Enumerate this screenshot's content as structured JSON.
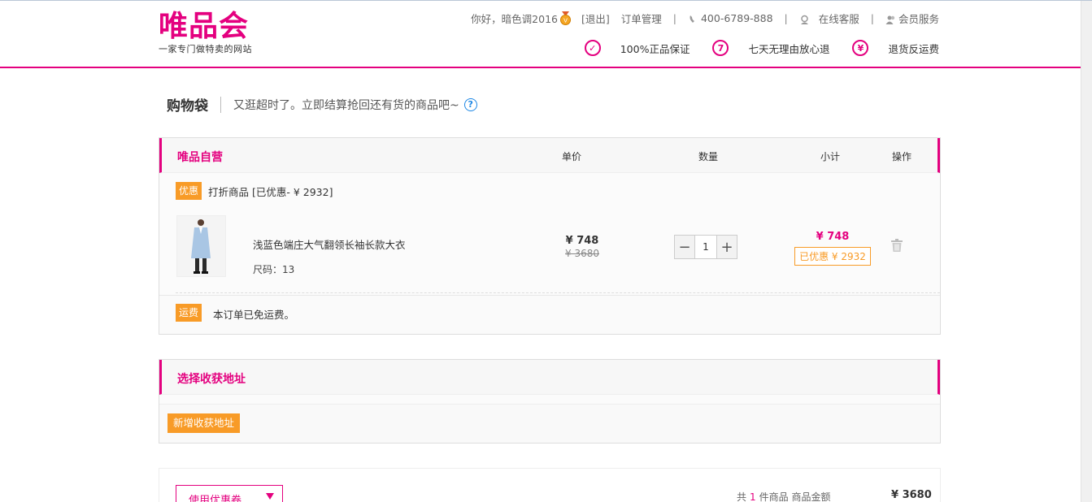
{
  "header": {
    "logo_text": "唯品会",
    "logo_sub": "一家专门做特卖的网站",
    "greeting": "你好，",
    "username": "暗色调2016",
    "logout": "[退出]",
    "orders": "订单管理",
    "phone": "400-6789-888",
    "service": "在线客服",
    "member": "会员服务",
    "separator": "|",
    "promises": [
      {
        "icon": "check-circle-icon",
        "glyph": "✓",
        "label": "100%正品保证"
      },
      {
        "icon": "seven-day-icon",
        "glyph": "7",
        "label": "七天无理由放心退"
      },
      {
        "icon": "yen-circle-icon",
        "glyph": "¥",
        "label": "退货反运费"
      }
    ]
  },
  "page": {
    "title": "购物袋",
    "notice": "又逛超时了。立即结算抢回还有货的商品吧~",
    "help_glyph": "?"
  },
  "cart": {
    "seller": "唯品自营",
    "columns": {
      "price": "单价",
      "qty": "数量",
      "subtotal": "小计",
      "action": "操作"
    },
    "promo_tag": "优惠",
    "promo_text": "打折商品 [已优惠- ¥ 2932]",
    "item": {
      "name": "浅蓝色端庄大气翻领长袖长款大衣",
      "size": "尺码：13",
      "price_now": "¥ 748",
      "price_old": "¥ 3680",
      "qty": "1",
      "subtotal": "¥ 748",
      "saved": "已优惠 ¥ 2932"
    },
    "shipping_tag": "运费",
    "shipping_text": "本订单已免运费。"
  },
  "address": {
    "title": "选择收获地址",
    "add_button": "新增收获地址"
  },
  "summary": {
    "coupon": "使用优惠卷",
    "count_prefix": "共",
    "count": "1",
    "count_suffix": "件商品 商品金额",
    "total": "¥ 3680"
  },
  "colors": {
    "brand": "#e4007f",
    "accent": "#f89b27",
    "help": "#1e88e5"
  }
}
